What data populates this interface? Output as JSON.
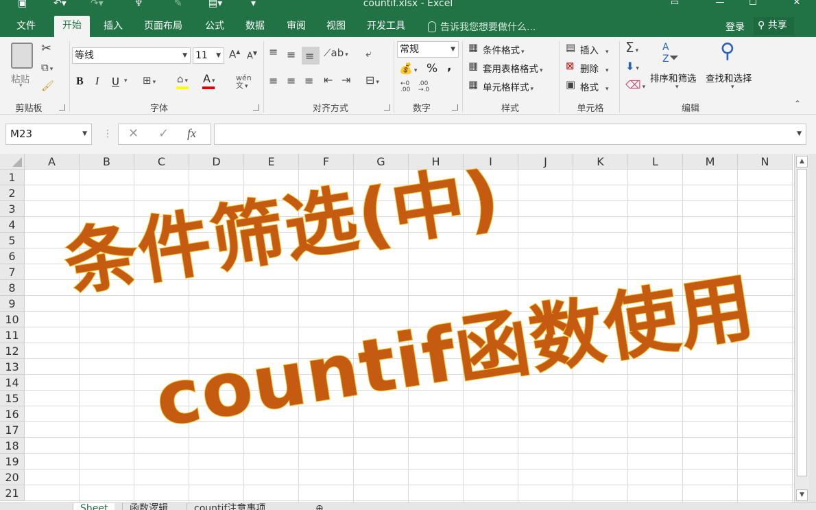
{
  "app": {
    "title": "countif.xlsx - Excel",
    "colors": {
      "brand": "#217346",
      "overlay_text": "#c55a11",
      "overlay_outline": "#f2c12e"
    }
  },
  "tabs": {
    "file": "文件",
    "items": [
      "开始",
      "插入",
      "页面布局",
      "公式",
      "数据",
      "审阅",
      "视图",
      "开发工具"
    ],
    "tell_me": "告诉我您想要做什么...",
    "login": "登录",
    "share": "共享"
  },
  "ribbon": {
    "clipboard": {
      "paste": "粘贴",
      "label": "剪贴板"
    },
    "font": {
      "name": "等线",
      "size": "11",
      "label": "字体",
      "bold": "B",
      "italic": "I",
      "underline": "U"
    },
    "alignment": {
      "label": "对齐方式"
    },
    "number": {
      "format": "常规",
      "percent": "%",
      "comma": ",",
      "label": "数字"
    },
    "styles": {
      "conditional": "条件格式",
      "table": "套用表格格式",
      "cell": "单元格样式",
      "label": "样式"
    },
    "cells": {
      "insert": "插入",
      "delete": "删除",
      "format": "格式",
      "label": "单元格"
    },
    "editing": {
      "sort": "排序和筛选",
      "find": "查找和选择",
      "label": "编辑"
    }
  },
  "formula_bar": {
    "name_box": "M23",
    "cancel": "✕",
    "enter": "✓",
    "fx": "fx",
    "value": ""
  },
  "grid": {
    "columns": [
      "A",
      "B",
      "C",
      "D",
      "E",
      "F",
      "G",
      "H",
      "I",
      "J",
      "K",
      "L",
      "M",
      "N"
    ],
    "rows": [
      "1",
      "2",
      "3",
      "4",
      "5",
      "6",
      "7",
      "8",
      "9",
      "10",
      "11",
      "12",
      "13",
      "14",
      "15",
      "16",
      "17",
      "18",
      "19",
      "20",
      "21"
    ]
  },
  "overlay": {
    "line1": "条件筛选(中)",
    "line2": "countif函数使用"
  },
  "sheets": [
    "Sheet",
    "函数逻辑",
    "countif注意事项"
  ]
}
